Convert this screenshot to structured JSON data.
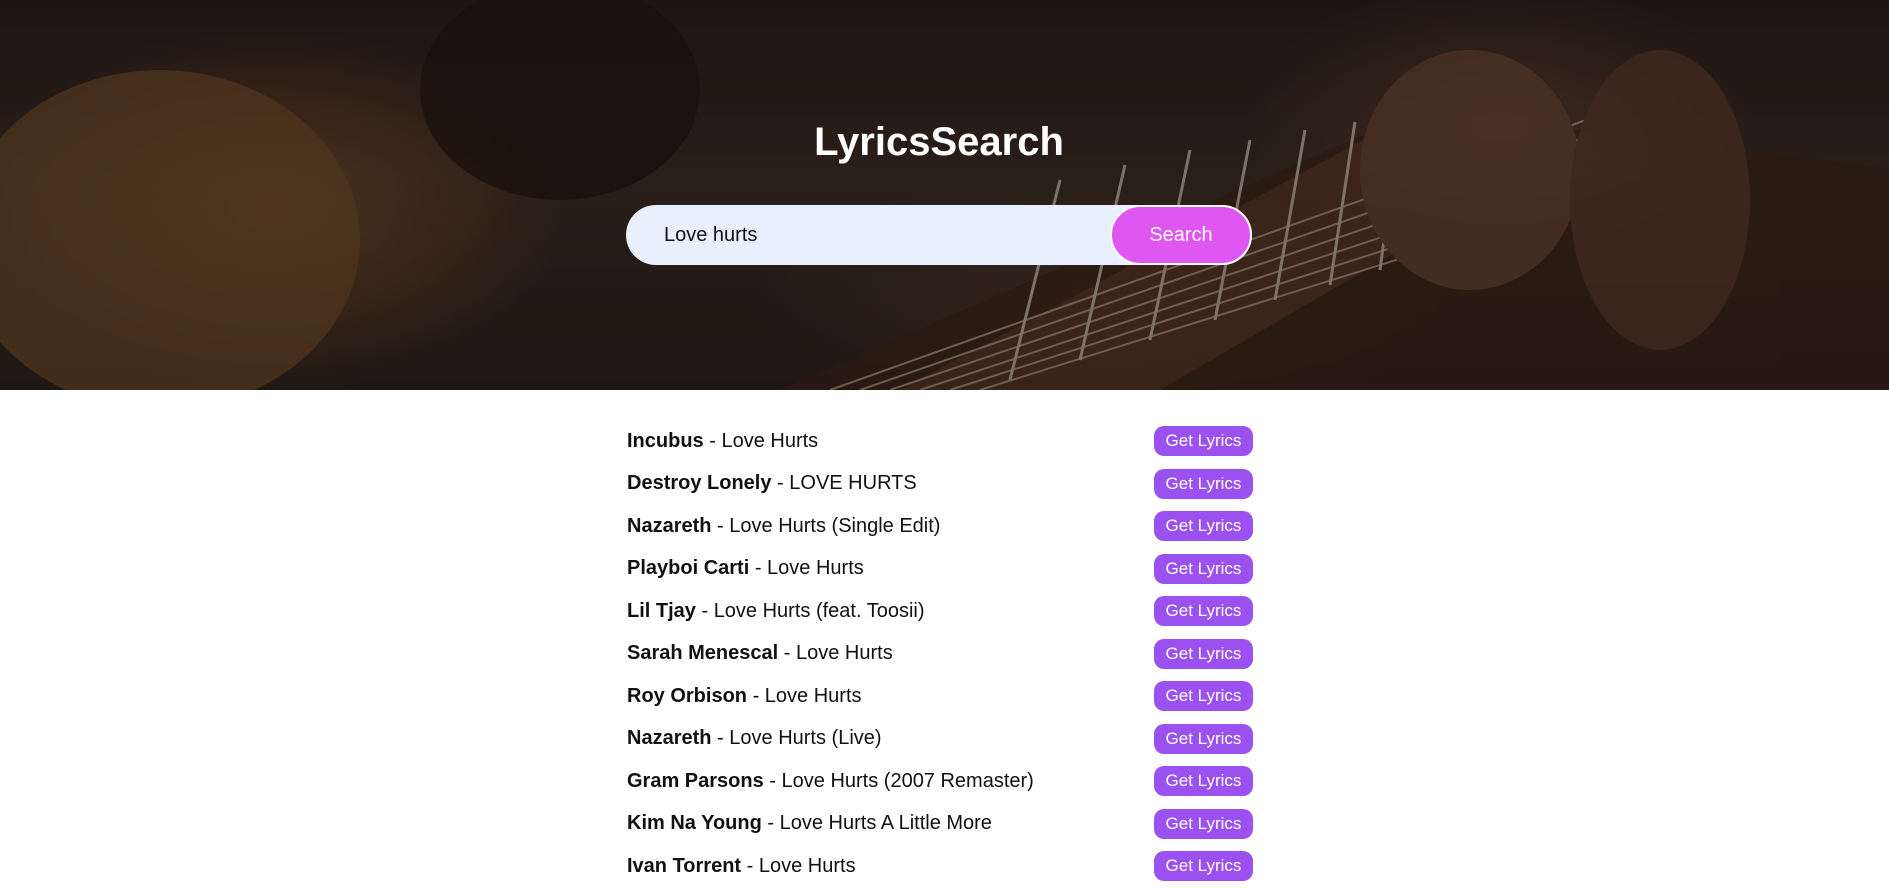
{
  "header": {
    "title": "LyricsSearch"
  },
  "search": {
    "value": "Love hurts",
    "button_label": "Search"
  },
  "results": [
    {
      "artist": "Incubus",
      "separator": " - ",
      "song": "Love Hurts",
      "button_label": "Get Lyrics"
    },
    {
      "artist": "Destroy Lonely",
      "separator": " - ",
      "song": "LOVE HURTS",
      "button_label": "Get Lyrics"
    },
    {
      "artist": "Nazareth",
      "separator": " - ",
      "song": "Love Hurts (Single Edit)",
      "button_label": "Get Lyrics"
    },
    {
      "artist": "Playboi Carti",
      "separator": " - ",
      "song": "Love Hurts",
      "button_label": "Get Lyrics"
    },
    {
      "artist": "Lil Tjay",
      "separator": " - ",
      "song": "Love Hurts (feat. Toosii)",
      "button_label": "Get Lyrics"
    },
    {
      "artist": "Sarah Menescal",
      "separator": " - ",
      "song": "Love Hurts",
      "button_label": "Get Lyrics"
    },
    {
      "artist": "Roy Orbison",
      "separator": " - ",
      "song": "Love Hurts",
      "button_label": "Get Lyrics"
    },
    {
      "artist": "Nazareth",
      "separator": " - ",
      "song": "Love Hurts (Live)",
      "button_label": "Get Lyrics"
    },
    {
      "artist": "Gram Parsons",
      "separator": " - ",
      "song": "Love Hurts (2007 Remaster)",
      "button_label": "Get Lyrics"
    },
    {
      "artist": "Kim Na Young",
      "separator": " - ",
      "song": "Love Hurts A Little More",
      "button_label": "Get Lyrics"
    },
    {
      "artist": "Ivan Torrent",
      "separator": " - ",
      "song": "Love Hurts",
      "button_label": "Get Lyrics"
    }
  ],
  "colors": {
    "search_button": "#e056f2",
    "lyrics_button": "#9b51ef",
    "search_field": "#e8f0fe"
  },
  "icons": {
    "hero_image": "guitar-photo"
  }
}
